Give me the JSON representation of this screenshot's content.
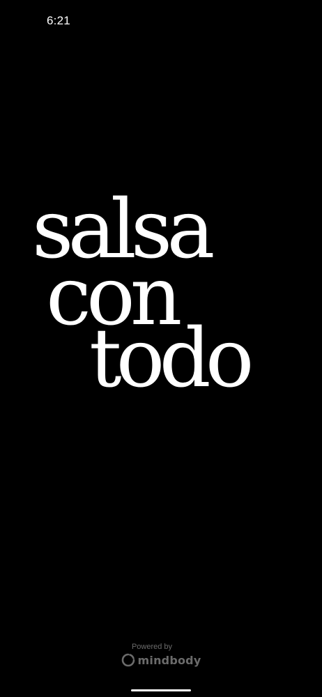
{
  "status_bar": {
    "time": "6:21"
  },
  "splash": {
    "logo_lines": [
      "salsa",
      "con",
      "todo"
    ]
  },
  "footer": {
    "powered_by": "Powered by",
    "brand": "mindbody",
    "brand_icon": "mindbody-logo-icon"
  },
  "colors": {
    "background": "#000000",
    "logo_text": "#ffffff",
    "footer_text": "#6b6b6b"
  }
}
